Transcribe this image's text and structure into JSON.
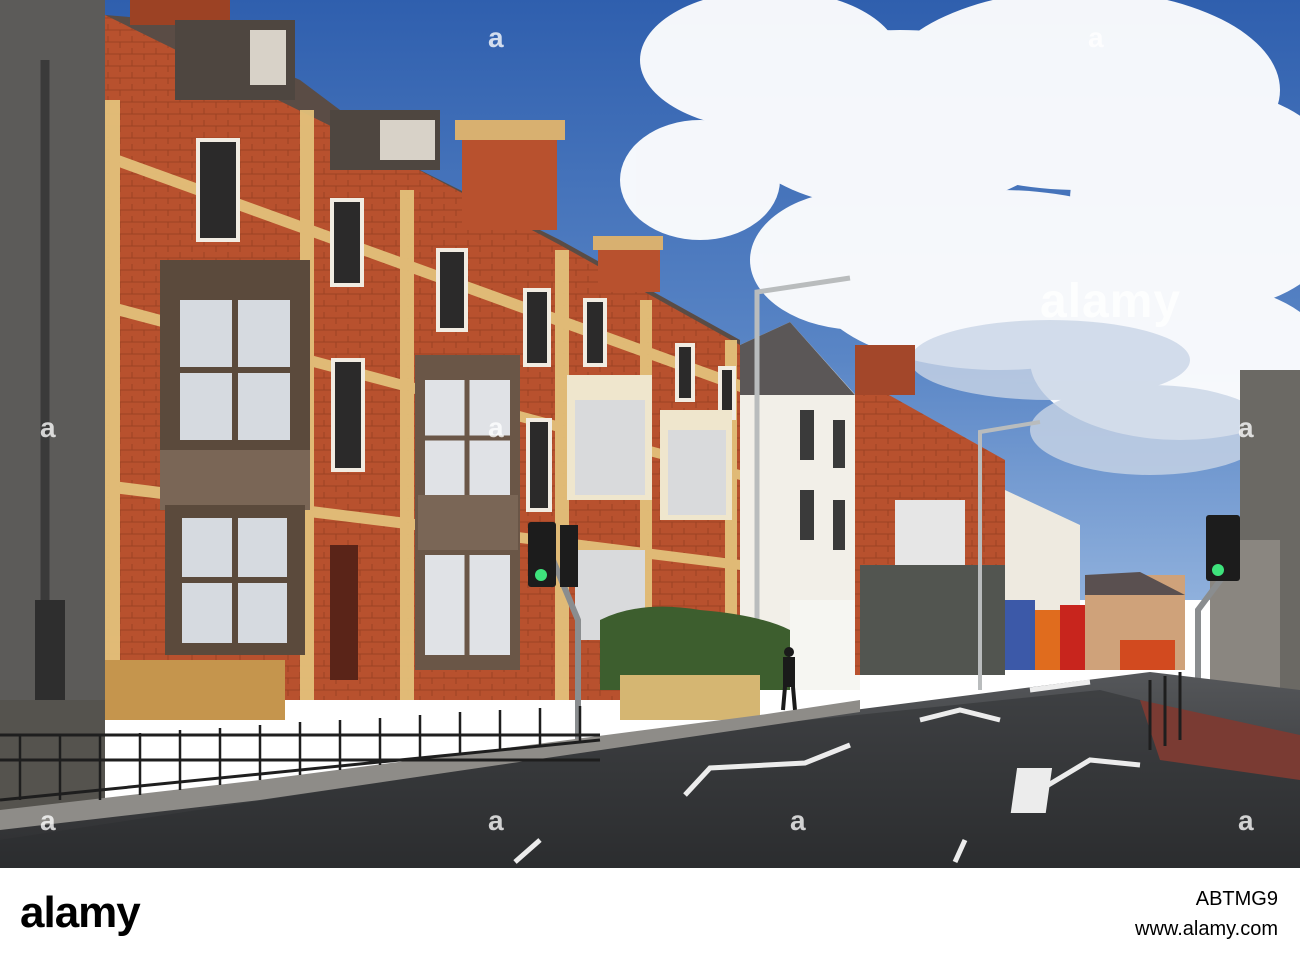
{
  "watermark": {
    "brand": "alamy",
    "edge_marks": [
      "a",
      "a",
      "a",
      "a",
      "a",
      "a",
      "a",
      "a",
      "a"
    ]
  },
  "footer": {
    "logo": "alamy",
    "image_code": "ABTMG9",
    "url": "www.alamy.com"
  },
  "colors": {
    "sky": "#3f6fb8",
    "brick": "#b8512e",
    "yellow_brick": "#e3c07a",
    "road": "#3b3d40"
  }
}
